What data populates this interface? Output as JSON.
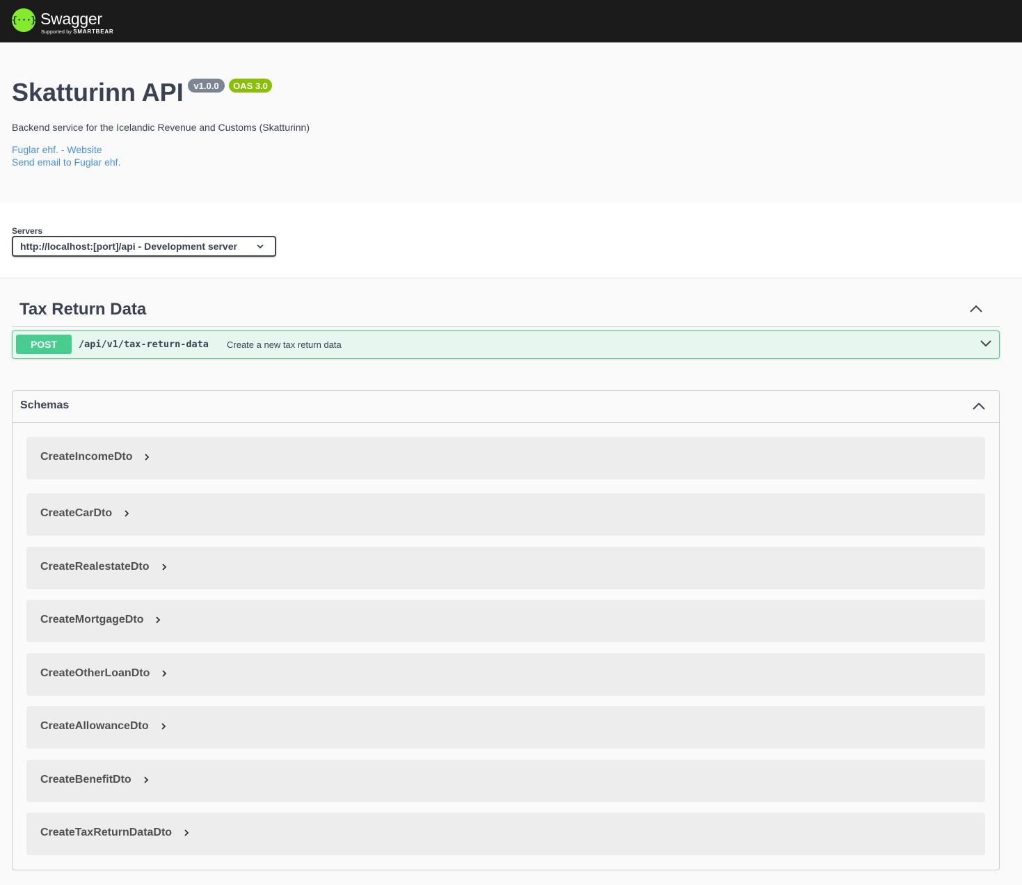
{
  "topbar": {
    "brand": "Swagger",
    "logo_glyph": "{···}",
    "supported_by": "Supported by",
    "supporter": "SMARTBEAR"
  },
  "info": {
    "title": "Skatturinn API",
    "version": "v1.0.0",
    "oas": "OAS 3.0",
    "description": "Backend service for the Icelandic Revenue and Customs (Skatturinn)",
    "links": [
      "Fuglar ehf. - Website",
      "Send email to Fuglar ehf."
    ]
  },
  "servers": {
    "label": "Servers",
    "selected": "http://localhost:[port]/api - Development server"
  },
  "tag": {
    "title": "Tax Return Data",
    "toggle_icon": "chevron-up-icon"
  },
  "operation": {
    "method": "POST",
    "path": "/api/v1/tax-return-data",
    "summary": "Create a new tax return data",
    "method_color": "#49cc90",
    "toggle_icon": "chevron-down-icon"
  },
  "schemas": {
    "title": "Schemas",
    "toggle_icon": "chevron-up-icon",
    "models": [
      "CreateIncomeDto",
      "CreateCarDto",
      "CreateRealestateDto",
      "CreateMortgageDto",
      "CreateOtherLoanDto",
      "CreateAllowanceDto",
      "CreateBenefitDto",
      "CreateTaxReturnDataDto"
    ]
  },
  "colors": {
    "topbar": "#1b1b1b",
    "logo_green": "#85ea2d",
    "link": "#4990e2",
    "version_badge": "#7d8492",
    "oas_badge": "#89bf04"
  }
}
